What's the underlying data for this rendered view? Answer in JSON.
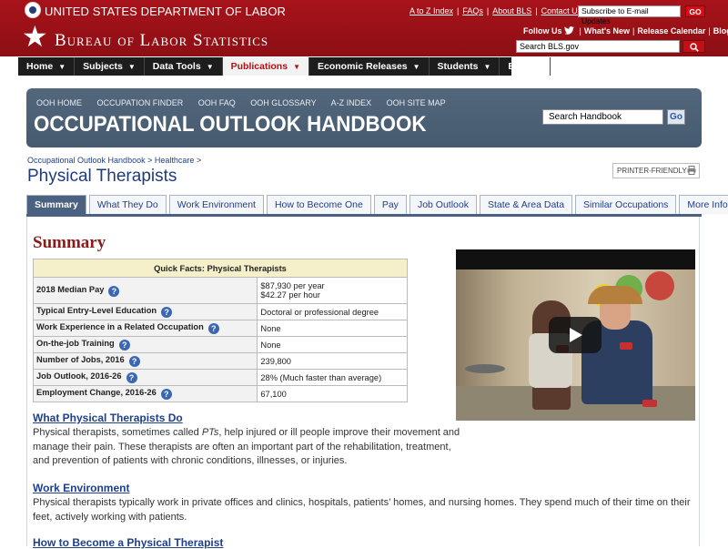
{
  "top": {
    "dol_title": "UNITED STATES DEPARTMENT OF LABOR",
    "links": [
      "A to Z Index",
      "FAQs",
      "About BLS",
      "Contact Us"
    ],
    "email_placeholder": "Subscribe to E-mail Updates",
    "go_label": "GO",
    "bls_title": "Bureau of Labor Statistics",
    "follow_label": "Follow Us",
    "whats_new": "What's New",
    "release_calendar": "Release Calendar",
    "blog": "Blog",
    "search_placeholder": "Search BLS.gov",
    "accent": "#a8131a"
  },
  "nav": [
    {
      "label": "Home"
    },
    {
      "label": "Subjects"
    },
    {
      "label": "Data Tools"
    },
    {
      "label": "Publications"
    },
    {
      "label": "Economic Releases"
    },
    {
      "label": "Students"
    },
    {
      "label": "Beta"
    }
  ],
  "ooh": {
    "links": [
      "OOH HOME",
      "OCCUPATION FINDER",
      "OOH FAQ",
      "OOH GLOSSARY",
      "A-Z INDEX",
      "OOH SITE MAP"
    ],
    "title": "OCCUPATIONAL OUTLOOK HANDBOOK",
    "search_placeholder": "Search Handbook",
    "go_label": "Go"
  },
  "breadcrumb": {
    "handbook": "Occupational Outlook Handbook",
    "sep": ">",
    "category": "Healthcare"
  },
  "page_title": "Physical Therapists",
  "printer_label": "PRINTER-FRIENDLY",
  "tabs": [
    {
      "label": "Summary"
    },
    {
      "label": "What They Do"
    },
    {
      "label": "Work Environment"
    },
    {
      "label": "How to Become One"
    },
    {
      "label": "Pay"
    },
    {
      "label": "Job Outlook"
    },
    {
      "label": "State & Area Data"
    },
    {
      "label": "Similar Occupations"
    },
    {
      "label": "More Info"
    }
  ],
  "summary": {
    "heading": "Summary",
    "table_title": "Quick Facts: Physical Therapists",
    "rows": [
      {
        "key": "2018 Median Pay",
        "value": "$87,930 per year",
        "value2": "$42.27 per hour"
      },
      {
        "key": "Typical Entry-Level Education",
        "value": "Doctoral or professional degree"
      },
      {
        "key": "Work Experience in a Related Occupation",
        "value": "None"
      },
      {
        "key": "On-the-job Training",
        "value": "None"
      },
      {
        "key": "Number of Jobs, 2016",
        "value": "239,800"
      },
      {
        "key": "Job Outlook, 2016-26",
        "value": "28% (Much faster than average)"
      },
      {
        "key": "Employment Change, 2016-26",
        "value": "67,100"
      }
    ]
  },
  "sections": [
    {
      "title": "What Physical Therapists Do",
      "text_before": "Physical therapists, sometimes called ",
      "text_em": "PTs",
      "text_after": ", help injured or ill people improve their movement and manage their pain. These therapists are often an important part of the rehabilitation, treatment, and prevention of patients with chronic conditions, illnesses, or injuries."
    },
    {
      "title": "Work Environment",
      "text": "Physical therapists typically work in private offices and clinics, hospitals, patients’ homes, and nursing homes. They spend much of their time on their feet, actively working with patients."
    },
    {
      "title": "How to Become a Physical Therapist"
    }
  ]
}
